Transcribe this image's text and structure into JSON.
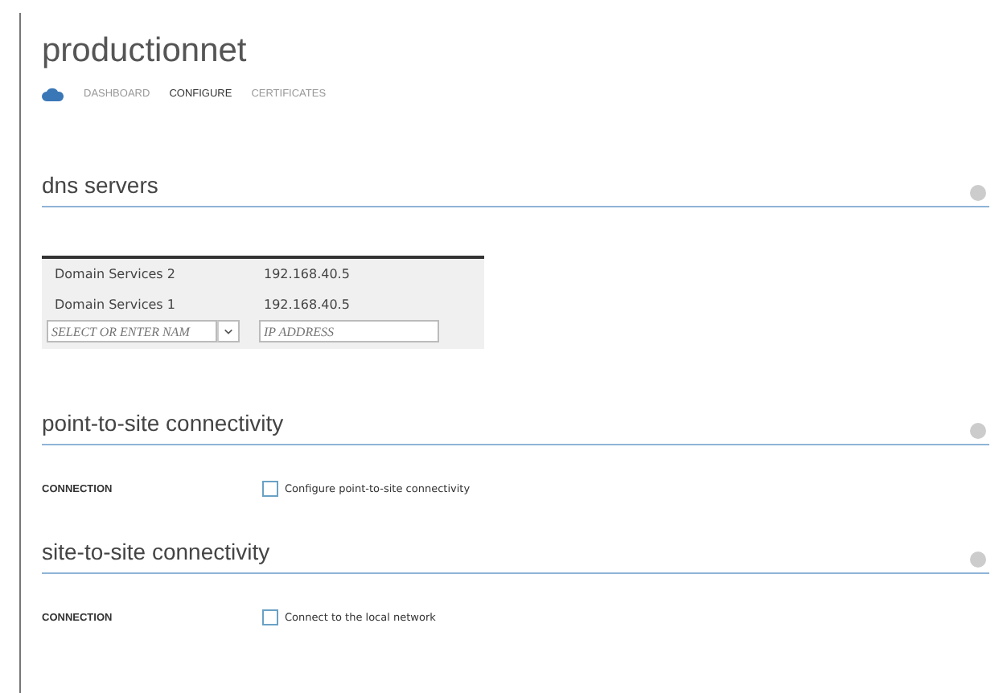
{
  "title": "productionnet",
  "tabs": [
    {
      "label": "DASHBOARD",
      "selected": false
    },
    {
      "label": "CONFIGURE",
      "selected": true
    },
    {
      "label": "CERTIFICATES",
      "selected": false
    }
  ],
  "sections": [
    {
      "heading": "dns servers",
      "kind": "dns",
      "rows": [
        {
          "name": "Domain Services 2",
          "address": "192.168.40.5"
        },
        {
          "name": "Domain Services 1",
          "address": "192.168.40.5"
        }
      ],
      "name_placeholder": "SELECT OR ENTER NAM",
      "address_placeholder": "IP ADDRESS"
    },
    {
      "heading": "point-to-site connectivity",
      "kind": "option",
      "label": "CONNECTION",
      "option": "Configure point-to-site connectivity",
      "checked": false
    },
    {
      "heading": "site-to-site connectivity",
      "kind": "option",
      "label": "CONNECTION",
      "option": "Connect to the local network",
      "checked": false
    }
  ]
}
